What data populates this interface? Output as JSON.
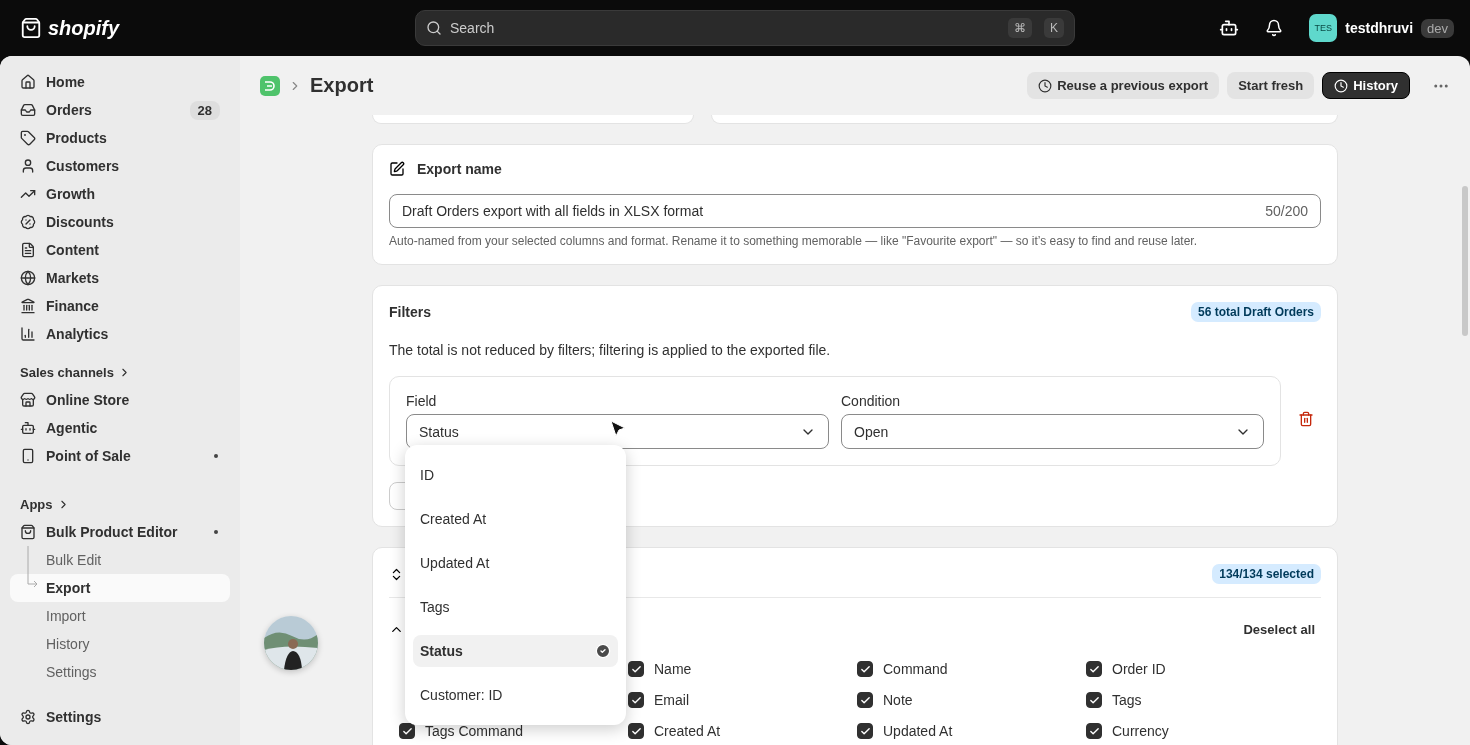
{
  "topbar": {
    "brand": "shopify",
    "search": {
      "placeholder": "Search",
      "keys": [
        "⌘",
        "K"
      ]
    },
    "user": {
      "initials": "TES",
      "name": "testdhruvi",
      "tag": "dev"
    }
  },
  "sidebar": {
    "items": [
      {
        "label": "Home",
        "selected": false
      },
      {
        "label": "Orders",
        "badge": "28",
        "selected": false
      },
      {
        "label": "Products",
        "selected": false
      },
      {
        "label": "Customers",
        "selected": false
      },
      {
        "label": "Growth",
        "selected": false
      },
      {
        "label": "Discounts",
        "selected": false
      },
      {
        "label": "Content",
        "selected": false
      },
      {
        "label": "Markets",
        "selected": false
      },
      {
        "label": "Finance",
        "selected": false
      },
      {
        "label": "Analytics",
        "selected": false
      }
    ],
    "sections": [
      {
        "title": "Sales channels",
        "items": [
          {
            "label": "Online Store",
            "dot": false
          },
          {
            "label": "Agentic",
            "dot": false
          },
          {
            "label": "Point of Sale",
            "dot": true
          }
        ]
      },
      {
        "title": "Apps",
        "items": [
          {
            "label": "Bulk Product Editor",
            "dot": true,
            "children": [
              {
                "label": "Bulk Edit",
                "selected": false
              },
              {
                "label": "Export",
                "selected": true
              },
              {
                "label": "Import",
                "selected": false
              },
              {
                "label": "History",
                "selected": false
              },
              {
                "label": "Settings",
                "selected": false
              }
            ]
          }
        ]
      }
    ],
    "footer": {
      "label": "Settings"
    }
  },
  "header": {
    "title": "Export",
    "actions": [
      {
        "label": "Reuse a previous export",
        "kind": "clock"
      },
      {
        "label": "Start fresh",
        "kind": "plain"
      },
      {
        "label": "History",
        "kind": "primary"
      }
    ]
  },
  "export_name": {
    "title": "Export name",
    "value": "Draft Orders export with all fields in XLSX format",
    "counter": "50/200",
    "help": "Auto-named from your selected columns and format. Rename it to something memorable — like \"Favourite export\" — so it’s easy to find and reuse later."
  },
  "filters": {
    "title": "Filters",
    "badge": "56 total Draft Orders",
    "note": "The total is not reduced by filters; filtering is applied to the exported file.",
    "field_label": "Field",
    "field_value": "Status",
    "condition_label": "Condition",
    "condition_value": "Open"
  },
  "dropdown": {
    "options": [
      {
        "label": "ID",
        "selected": false
      },
      {
        "label": "Created At",
        "selected": false
      },
      {
        "label": "Updated At",
        "selected": false
      },
      {
        "label": "Tags",
        "selected": false
      },
      {
        "label": "Status",
        "selected": true
      },
      {
        "label": "Customer: ID",
        "selected": false
      }
    ]
  },
  "columns": {
    "badge": "134/134 selected",
    "deselect": "Deselect all",
    "rows": [
      {
        "cells": [
          null,
          {
            "label": "Name",
            "checked": true
          },
          {
            "label": "Command",
            "checked": true
          },
          {
            "label": "Order ID",
            "checked": true
          }
        ]
      },
      {
        "cells": [
          null,
          {
            "label": "Email",
            "checked": true
          },
          {
            "label": "Note",
            "checked": true
          },
          {
            "label": "Tags",
            "checked": true
          }
        ]
      },
      {
        "cells": [
          {
            "label": "Tags Command",
            "checked": true
          },
          {
            "label": "Created At",
            "checked": true
          },
          {
            "label": "Updated At",
            "checked": true
          },
          {
            "label": "Currency",
            "checked": true
          }
        ]
      }
    ]
  }
}
